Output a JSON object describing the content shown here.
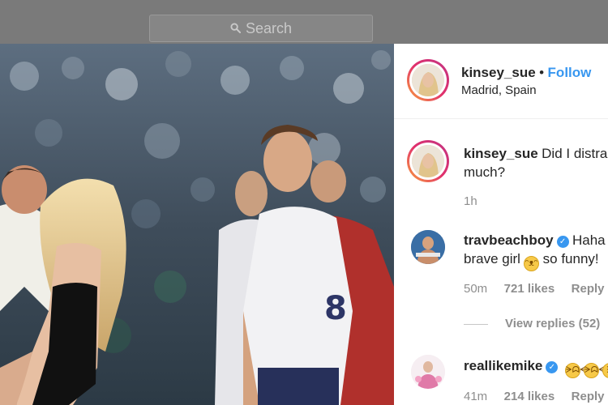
{
  "topbar": {
    "search_placeholder": "Search",
    "search_icon": "search-icon"
  },
  "post": {
    "author": {
      "username": "kinsey_sue",
      "separator": "•",
      "follow_label": "Follow",
      "location": "Madrid, Spain"
    },
    "caption": {
      "username": "kinsey_sue",
      "text": "Did I distract you too much?",
      "line1": "Did I distra",
      "line2": "much?",
      "time": "1h"
    },
    "comments": [
      {
        "username": "travbeachboy",
        "verified": true,
        "line1": "Haha",
        "line2": "brave girl",
        "emoji": "grinning-cat-emoji",
        "line2_end": "so funny!",
        "time": "50m",
        "likes": "721 likes",
        "reply_label": "Reply",
        "view_replies": "View replies (52)"
      },
      {
        "username": "reallikemike",
        "verified": true,
        "emojis": [
          "tears-of-joy-emoji",
          "tears-of-joy-emoji"
        ],
        "time": "41m",
        "likes": "214 likes",
        "reply_label": "Reply"
      }
    ]
  },
  "colors": {
    "link_blue": "#3897f0",
    "text_dark": "#262626",
    "text_grey": "#8e8e8e",
    "topbar_bg": "#7a7a7a"
  }
}
